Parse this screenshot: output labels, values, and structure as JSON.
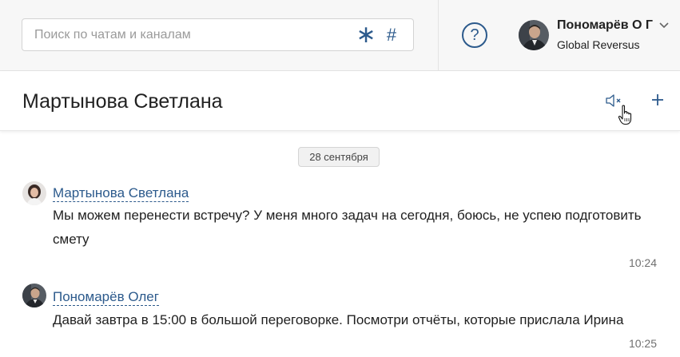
{
  "search": {
    "placeholder": "Поиск по чатам и каналам",
    "value": "",
    "filter_icons": [
      "asterisk-icon",
      "hash-icon"
    ],
    "hash_symbol": "#"
  },
  "header": {
    "help_symbol": "?",
    "user": {
      "name": "Пономарёв О Г",
      "org": "Global Reversus"
    }
  },
  "chat": {
    "title": "Мартынова Светлана",
    "actions": [
      "mute-icon",
      "plus-icon"
    ]
  },
  "date_separator": "28 сентября",
  "messages": [
    {
      "author": "Мартынова Светлана",
      "text": "Мы можем перенести встречу? У меня много задач на сегодня, боюсь, не успею подготовить смету",
      "time": "10:24"
    },
    {
      "author": "Пономарёв Олег",
      "text": "Давай завтра в 15:00 в большой переговорке. Посмотри отчёты, которые прислала Ирина",
      "time": "10:25"
    }
  ],
  "colors": {
    "accent": "#2c5a8c",
    "topbar_bg": "#f7f7f7",
    "text": "#212121",
    "muted": "#6f6f6f"
  }
}
